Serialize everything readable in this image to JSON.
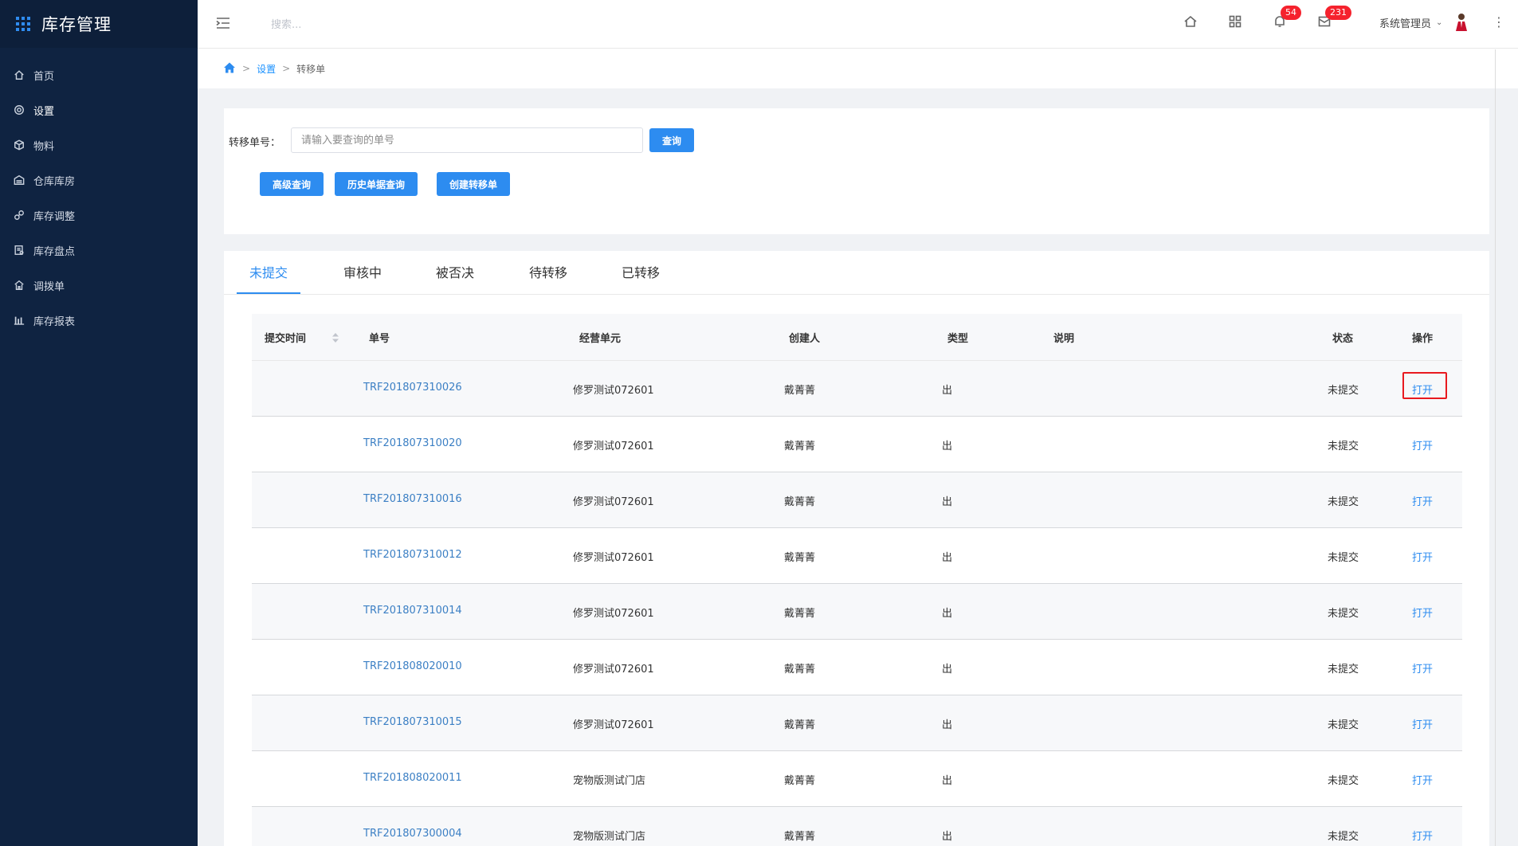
{
  "app": {
    "title": "库存管理"
  },
  "sidebar": {
    "items": [
      {
        "label": "首页",
        "icon": "home-icon"
      },
      {
        "label": "设置",
        "icon": "gear-icon"
      },
      {
        "label": "物料",
        "icon": "cube-icon"
      },
      {
        "label": "仓库库房",
        "icon": "warehouse-icon"
      },
      {
        "label": "库存调整",
        "icon": "adjust-icon"
      },
      {
        "label": "库存盘点",
        "icon": "inventory-check-icon"
      },
      {
        "label": "调拨单",
        "icon": "transfer-icon"
      },
      {
        "label": "库存报表",
        "icon": "bar-chart-icon"
      }
    ],
    "active_index": 1
  },
  "header": {
    "search_placeholder": "搜索...",
    "notifications_count": "54",
    "messages_count": "231",
    "user_name": "系统管理员"
  },
  "breadcrumb": {
    "level1": "设置",
    "level2": "转移单"
  },
  "search_panel": {
    "label": "转移单号：",
    "placeholder": "请输入要查询的单号",
    "query_button": "查询",
    "advanced_button": "高级查询",
    "history_button": "历史单据查询",
    "create_button": "创建转移单"
  },
  "tabs": [
    {
      "label": "未提交",
      "active": true
    },
    {
      "label": "审核中",
      "active": false
    },
    {
      "label": "被否决",
      "active": false
    },
    {
      "label": "待转移",
      "active": false
    },
    {
      "label": "已转移",
      "active": false
    }
  ],
  "table": {
    "columns": {
      "submit_time": "提交时间",
      "number": "单号",
      "unit": "经营单元",
      "creator": "创建人",
      "type": "类型",
      "note": "说明",
      "status": "状态",
      "action": "操作"
    },
    "rows": [
      {
        "number": "TRF201807310026",
        "unit": "修罗测试072601",
        "creator": "戴菁菁",
        "type": "出",
        "status": "未提交",
        "action": "打开"
      },
      {
        "number": "TRF201807310020",
        "unit": "修罗测试072601",
        "creator": "戴菁菁",
        "type": "出",
        "status": "未提交",
        "action": "打开"
      },
      {
        "number": "TRF201807310016",
        "unit": "修罗测试072601",
        "creator": "戴菁菁",
        "type": "出",
        "status": "未提交",
        "action": "打开"
      },
      {
        "number": "TRF201807310012",
        "unit": "修罗测试072601",
        "creator": "戴菁菁",
        "type": "出",
        "status": "未提交",
        "action": "打开"
      },
      {
        "number": "TRF201807310014",
        "unit": "修罗测试072601",
        "creator": "戴菁菁",
        "type": "出",
        "status": "未提交",
        "action": "打开"
      },
      {
        "number": "TRF201808020010",
        "unit": "修罗测试072601",
        "creator": "戴菁菁",
        "type": "出",
        "status": "未提交",
        "action": "打开"
      },
      {
        "number": "TRF201807310015",
        "unit": "修罗测试072601",
        "creator": "戴菁菁",
        "type": "出",
        "status": "未提交",
        "action": "打开"
      },
      {
        "number": "TRF201808020011",
        "unit": "宠物版测试门店",
        "creator": "戴菁菁",
        "type": "出",
        "status": "未提交",
        "action": "打开"
      },
      {
        "number": "TRF201807300004",
        "unit": "宠物版测试门店",
        "creator": "戴菁菁",
        "type": "出",
        "status": "未提交",
        "action": "打开"
      }
    ]
  },
  "colors": {
    "sidebar_bg": "#0f2341",
    "primary": "#2d8cf0",
    "badge": "#f5222d",
    "highlight_box": "#e8191f"
  }
}
